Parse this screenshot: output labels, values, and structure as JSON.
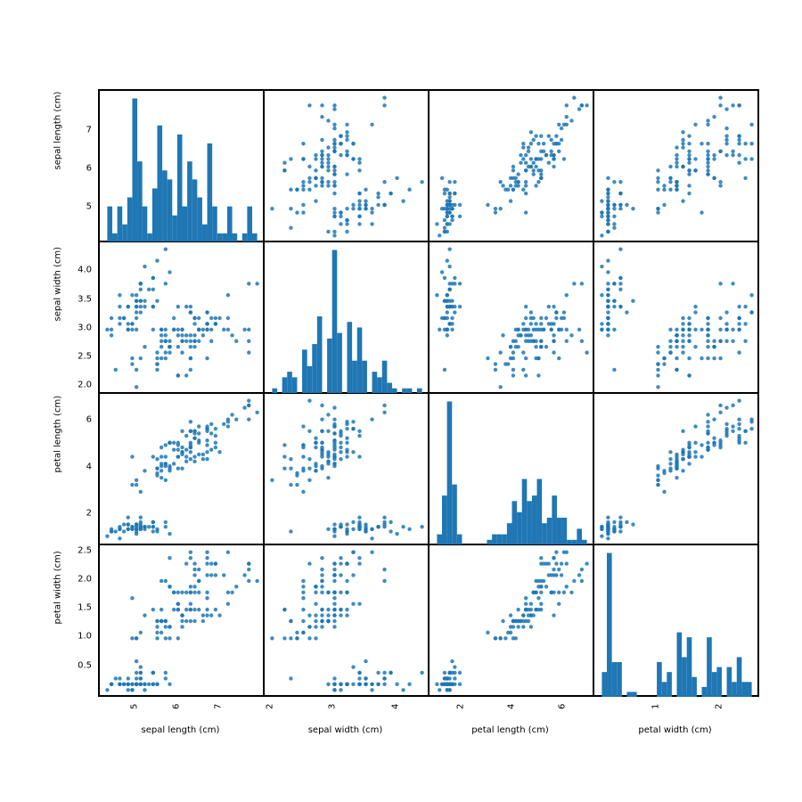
{
  "chart_data": {
    "type": "scatter_matrix",
    "title": "",
    "features": [
      "sepal length (cm)",
      "sepal width (cm)",
      "petal length (cm)",
      "petal width (cm)"
    ],
    "color": "#1f77b4",
    "data": {
      "sepal length (cm)": [
        5.1,
        4.9,
        4.7,
        4.6,
        5.0,
        5.4,
        4.6,
        5.0,
        4.4,
        4.9,
        5.4,
        4.8,
        4.8,
        4.3,
        5.8,
        5.7,
        5.4,
        5.1,
        5.7,
        5.1,
        5.4,
        5.1,
        4.6,
        5.1,
        4.8,
        5.0,
        5.0,
        5.2,
        5.2,
        4.7,
        4.8,
        5.4,
        5.2,
        5.5,
        4.9,
        5.0,
        5.5,
        4.9,
        4.4,
        5.1,
        5.0,
        4.5,
        4.4,
        5.0,
        5.1,
        4.8,
        5.1,
        4.6,
        5.3,
        5.0,
        7.0,
        6.4,
        6.9,
        5.5,
        6.5,
        5.7,
        6.3,
        4.9,
        6.6,
        5.2,
        5.0,
        5.9,
        6.0,
        6.1,
        5.6,
        6.7,
        5.6,
        5.8,
        6.2,
        5.6,
        5.9,
        6.1,
        6.3,
        6.1,
        6.4,
        6.6,
        6.8,
        6.7,
        6.0,
        5.7,
        5.5,
        5.5,
        5.8,
        6.0,
        5.4,
        6.0,
        6.7,
        6.3,
        5.6,
        5.5,
        5.5,
        6.1,
        5.8,
        5.0,
        5.6,
        5.7,
        5.7,
        6.2,
        5.1,
        5.7,
        6.3,
        5.8,
        7.1,
        6.3,
        6.5,
        7.6,
        4.9,
        7.3,
        6.7,
        7.2,
        6.5,
        6.4,
        6.8,
        5.7,
        5.8,
        6.4,
        6.5,
        7.7,
        7.7,
        6.0,
        6.9,
        5.6,
        7.7,
        6.3,
        6.7,
        7.2,
        6.2,
        6.1,
        6.4,
        7.2,
        7.4,
        7.9,
        6.4,
        6.3,
        6.1,
        7.7,
        6.3,
        6.4,
        6.0,
        6.9,
        6.7,
        6.9,
        5.8,
        6.8,
        6.7,
        6.7,
        6.3,
        6.5,
        6.2,
        5.9
      ],
      "sepal width (cm)": [
        3.5,
        3.0,
        3.2,
        3.1,
        3.6,
        3.9,
        3.4,
        3.4,
        2.9,
        3.1,
        3.7,
        3.4,
        3.0,
        3.0,
        4.0,
        4.4,
        3.9,
        3.5,
        3.8,
        3.8,
        3.4,
        3.7,
        3.6,
        3.3,
        3.4,
        3.0,
        3.4,
        3.5,
        3.4,
        3.2,
        3.1,
        3.4,
        4.1,
        4.2,
        3.1,
        3.2,
        3.5,
        3.6,
        3.0,
        3.4,
        3.5,
        2.3,
        3.2,
        3.5,
        3.8,
        3.0,
        3.8,
        3.2,
        3.7,
        3.3,
        3.2,
        3.2,
        3.1,
        2.3,
        2.8,
        2.8,
        3.3,
        2.4,
        2.9,
        2.7,
        2.0,
        3.0,
        2.2,
        2.9,
        2.9,
        3.1,
        3.0,
        2.7,
        2.2,
        2.5,
        3.2,
        2.8,
        2.5,
        2.8,
        2.9,
        3.0,
        2.8,
        3.0,
        2.9,
        2.6,
        2.4,
        2.4,
        2.7,
        2.7,
        3.0,
        3.4,
        3.1,
        2.3,
        3.0,
        2.5,
        2.6,
        3.0,
        2.6,
        2.3,
        2.7,
        3.0,
        2.9,
        2.9,
        2.5,
        2.8,
        3.3,
        2.7,
        3.0,
        2.9,
        3.0,
        3.0,
        2.5,
        2.9,
        2.5,
        3.6,
        3.2,
        2.7,
        3.0,
        2.5,
        2.8,
        3.2,
        3.0,
        3.8,
        2.6,
        2.2,
        3.2,
        2.8,
        2.8,
        2.7,
        3.3,
        3.2,
        2.8,
        3.0,
        2.8,
        3.0,
        2.8,
        3.8,
        2.8,
        2.8,
        2.6,
        3.0,
        3.4,
        3.1,
        3.0,
        3.1,
        3.1,
        3.1,
        2.7,
        3.2,
        3.3,
        3.0,
        2.5,
        3.0,
        3.4,
        3.0
      ],
      "petal length (cm)": [
        1.4,
        1.4,
        1.3,
        1.5,
        1.4,
        1.7,
        1.4,
        1.5,
        1.4,
        1.5,
        1.5,
        1.6,
        1.4,
        1.1,
        1.2,
        1.5,
        1.3,
        1.4,
        1.7,
        1.5,
        1.7,
        1.5,
        1.0,
        1.7,
        1.9,
        1.6,
        1.6,
        1.5,
        1.4,
        1.6,
        1.6,
        1.5,
        1.5,
        1.4,
        1.5,
        1.2,
        1.3,
        1.4,
        1.3,
        1.5,
        1.3,
        1.3,
        1.3,
        1.6,
        1.9,
        1.4,
        1.6,
        1.4,
        1.5,
        1.4,
        4.7,
        4.5,
        4.9,
        4.0,
        4.6,
        4.5,
        4.7,
        3.3,
        4.6,
        3.9,
        3.5,
        4.2,
        4.0,
        4.7,
        3.6,
        4.4,
        4.5,
        4.1,
        4.5,
        3.9,
        4.8,
        4.0,
        4.9,
        4.7,
        4.3,
        4.4,
        4.8,
        5.0,
        4.5,
        3.5,
        3.8,
        3.7,
        3.9,
        5.1,
        4.5,
        4.5,
        4.7,
        4.4,
        4.1,
        4.0,
        4.4,
        4.6,
        4.0,
        3.3,
        4.2,
        4.2,
        4.2,
        4.3,
        3.0,
        4.1,
        6.0,
        5.1,
        5.9,
        5.6,
        5.8,
        6.6,
        4.5,
        6.3,
        5.8,
        6.1,
        5.1,
        5.3,
        5.5,
        5.0,
        5.1,
        5.3,
        5.5,
        6.7,
        6.9,
        5.0,
        5.7,
        4.9,
        6.7,
        4.9,
        5.7,
        6.0,
        4.8,
        4.9,
        5.6,
        5.8,
        6.1,
        6.4,
        5.6,
        5.1,
        5.6,
        6.1,
        5.6,
        5.5,
        4.8,
        5.4,
        5.6,
        5.1,
        5.1,
        5.9,
        5.7,
        5.2,
        5.0,
        5.2,
        5.4,
        5.1
      ],
      "petal width (cm)": [
        0.2,
        0.2,
        0.2,
        0.2,
        0.2,
        0.4,
        0.3,
        0.2,
        0.2,
        0.1,
        0.2,
        0.2,
        0.1,
        0.1,
        0.2,
        0.4,
        0.4,
        0.3,
        0.3,
        0.3,
        0.2,
        0.4,
        0.2,
        0.5,
        0.2,
        0.2,
        0.4,
        0.2,
        0.2,
        0.2,
        0.2,
        0.4,
        0.1,
        0.2,
        0.2,
        0.2,
        0.2,
        0.1,
        0.2,
        0.2,
        0.3,
        0.3,
        0.2,
        0.6,
        0.4,
        0.3,
        0.2,
        0.2,
        0.2,
        0.2,
        1.4,
        1.5,
        1.5,
        1.3,
        1.5,
        1.3,
        1.6,
        1.0,
        1.3,
        1.4,
        1.0,
        1.5,
        1.0,
        1.4,
        1.3,
        1.4,
        1.5,
        1.0,
        1.5,
        1.1,
        1.8,
        1.3,
        1.5,
        1.2,
        1.3,
        1.4,
        1.4,
        1.7,
        1.5,
        1.0,
        1.1,
        1.0,
        1.2,
        1.6,
        1.5,
        1.6,
        1.5,
        1.3,
        1.3,
        1.3,
        1.2,
        1.4,
        1.2,
        1.0,
        1.3,
        1.2,
        1.3,
        1.3,
        1.1,
        1.3,
        2.5,
        1.9,
        2.1,
        1.8,
        2.2,
        2.1,
        1.7,
        1.8,
        1.8,
        2.5,
        2.0,
        1.9,
        2.1,
        2.0,
        2.4,
        2.3,
        1.8,
        2.2,
        2.3,
        1.5,
        2.3,
        2.0,
        2.0,
        1.8,
        2.1,
        1.8,
        1.8,
        1.8,
        2.1,
        1.6,
        1.9,
        2.0,
        2.2,
        1.5,
        1.4,
        2.3,
        2.4,
        1.8,
        1.8,
        2.1,
        2.4,
        2.3,
        1.9,
        2.3,
        2.5,
        2.3,
        1.9,
        2.0,
        2.3,
        1.8
      ]
    },
    "axes": [
      {
        "label": "sepal length (cm)",
        "ticks": [
          5,
          6,
          7
        ],
        "range": [
          4.12,
          8.08
        ]
      },
      {
        "label": "sepal width (cm)",
        "ticks": [
          2,
          3,
          4
        ],
        "range": [
          1.88,
          4.52
        ]
      },
      {
        "label": "petal length (cm)",
        "ticks": [
          2,
          4,
          6
        ],
        "range": [
          0.705,
          7.195
        ]
      },
      {
        "label": "petal width (cm)",
        "ticks": [
          1,
          2
        ],
        "range": [
          -0.02,
          2.62
        ]
      }
    ],
    "diag_yticks": [
      [
        5,
        6,
        7
      ],
      [
        2.0,
        2.5,
        3.0,
        3.5,
        4.0
      ],
      [
        2,
        4,
        6
      ],
      [
        0.5,
        1.0,
        1.5,
        2.0,
        2.5
      ]
    ],
    "hist_bins": 30
  }
}
